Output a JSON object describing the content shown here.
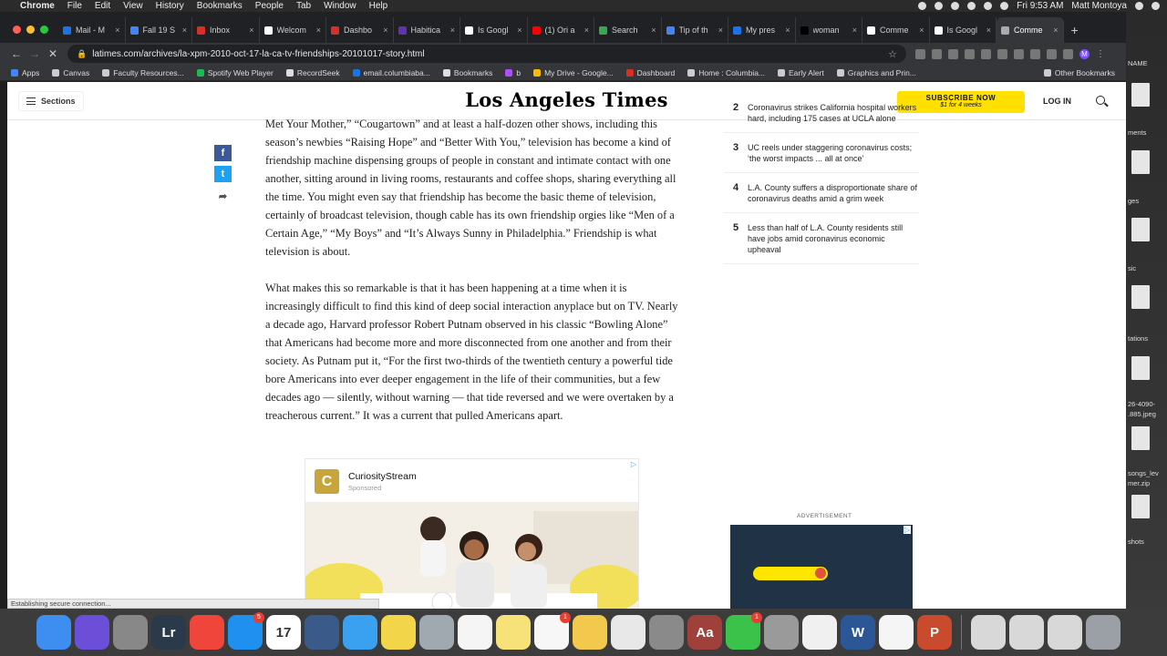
{
  "menubar": {
    "app": "Chrome",
    "items": [
      "File",
      "Edit",
      "View",
      "History",
      "Bookmarks",
      "People",
      "Tab",
      "Window",
      "Help"
    ],
    "clock": "Fri 9:53 AM",
    "user": "Matt Montoya"
  },
  "tabs": [
    {
      "label": "Mail - M",
      "color": "#1a73e8"
    },
    {
      "label": "Fall 19 S",
      "color": "#4285f4"
    },
    {
      "label": "Inbox",
      "color": "#d93025"
    },
    {
      "label": "Welcom",
      "color": "#ffffff"
    },
    {
      "label": "Dashbo",
      "color": "#d93025"
    },
    {
      "label": "Habitica",
      "color": "#6133b4"
    },
    {
      "label": "Is Googl",
      "color": "#ffffff"
    },
    {
      "label": "(1) Ori a",
      "color": "#ff0000"
    },
    {
      "label": "Search",
      "color": "#34a853"
    },
    {
      "label": "Tip of th",
      "color": "#4285f4"
    },
    {
      "label": "My pres",
      "color": "#1a73e8"
    },
    {
      "label": "woman",
      "color": "#000000"
    },
    {
      "label": "Comme",
      "color": "#ffffff"
    },
    {
      "label": "Is Googl",
      "color": "#ffffff"
    },
    {
      "label": "Comme",
      "color": "#aaaaaa"
    }
  ],
  "toolbar": {
    "url": "latimes.com/archives/la-xpm-2010-oct-17-la-ca-tv-friendships-20101017-story.html",
    "avatar": "M"
  },
  "bookmarks": [
    {
      "label": "Apps",
      "color": "#4285f4"
    },
    {
      "label": "Canvas",
      "color": "#cccccc"
    },
    {
      "label": "Faculty Resources...",
      "color": "#cccccc"
    },
    {
      "label": "Spotify Web Player",
      "color": "#1db954"
    },
    {
      "label": "RecordSeek",
      "color": "#dddddd"
    },
    {
      "label": "email.columbiaba...",
      "color": "#1a73e8"
    },
    {
      "label": "Bookmarks",
      "color": "#dddddd"
    },
    {
      "label": "b",
      "color": "#b04dff"
    },
    {
      "label": "My Drive - Google...",
      "color": "#fbbc04"
    },
    {
      "label": "Dashboard",
      "color": "#d93025"
    },
    {
      "label": "Home : Columbia...",
      "color": "#cccccc"
    },
    {
      "label": "Early Alert",
      "color": "#cccccc"
    },
    {
      "label": "Graphics and Prin...",
      "color": "#cccccc"
    }
  ],
  "other_bookmarks": "Other Bookmarks",
  "lat": {
    "sections": "Sections",
    "logo": "Los Angeles Times",
    "subscribe": "SUBSCRIBE NOW",
    "subscribe_offer": "$1 for 4 weeks",
    "login": "LOG IN"
  },
  "article": {
    "p1": "Met Your Mother,” “Cougartown” and at least a half-dozen other shows, including this season’s newbies “Raising Hope” and “Better With You,” television has become a kind of friendship machine dispensing groups of people in constant and intimate contact with one another, sitting around in living rooms, restaurants and coffee shops, sharing everything all the time. You might even say that friendship has become the basic theme of television, certainly of broadcast television, though cable has its own friendship orgies like “Men of a Certain Age,” “My Boys” and “It’s Always Sunny in Philadelphia.” Friendship is what television is about.",
    "p2": "What makes this so remarkable is that it has been happening at a time when it is increasingly difficult to find this kind of deep social interaction anyplace but on TV. Nearly a decade ago, Harvard professor Robert Putnam observed in his classic “Bowling Alone” that Americans had become more and more disconnected from one another and from their society. As Putnam put it, “For the first two-thirds of the twentieth century a powerful tide bore Americans into ever deeper engagement in the life of their communities, but a few decades ago — silently, without warning — that tide reversed and we were overtaken by a treacherous current.” It was a current that pulled Americans apart."
  },
  "ad": {
    "brand": "CuriosityStream",
    "sponsored": "Sponsored"
  },
  "toplist": [
    {
      "num": "2",
      "text": "Coronavirus strikes California hospital workers hard, including 175 cases at UCLA alone"
    },
    {
      "num": "3",
      "text": "UC reels under staggering coronavirus costs; ‘the worst impacts ... all at once’"
    },
    {
      "num": "4",
      "text": "L.A. County suffers a disproportionate share of coronavirus deaths amid a grim week"
    },
    {
      "num": "5",
      "text": "Less than half of L.A. County residents still have jobs amid coronavirus economic upheaval"
    }
  ],
  "advertisement_label": "ADVERTISEMENT",
  "status": "Establishing secure connection...",
  "desktop_labels": [
    "NAME",
    "ments",
    "ges",
    "sic",
    "tations",
    "26-4090-",
    ".885.jpeg",
    "songs_lev",
    "mer.zip",
    "shots"
  ],
  "dock": [
    {
      "name": "finder",
      "color": "#3d8ef0",
      "label": ""
    },
    {
      "name": "siri",
      "color": "#6b4fd8",
      "label": ""
    },
    {
      "name": "launchpad",
      "color": "#888888",
      "label": ""
    },
    {
      "name": "lightroom",
      "color": "#2b3a4a",
      "label": "Lr"
    },
    {
      "name": "news",
      "color": "#f0453a",
      "label": ""
    },
    {
      "name": "app-store",
      "color": "#1f8ff0",
      "label": "",
      "badge": "5"
    },
    {
      "name": "calendar",
      "color": "#ffffff",
      "label": "17"
    },
    {
      "name": "quicktime",
      "color": "#3a5a8a",
      "label": ""
    },
    {
      "name": "safari",
      "color": "#3aa0f0",
      "label": ""
    },
    {
      "name": "stickies",
      "color": "#f3d54a",
      "label": ""
    },
    {
      "name": "preview",
      "color": "#a0a8b0",
      "label": ""
    },
    {
      "name": "textedit",
      "color": "#f5f5f5",
      "label": ""
    },
    {
      "name": "notes",
      "color": "#f7e27a",
      "label": ""
    },
    {
      "name": "reminders",
      "color": "#f7f7f7",
      "label": "",
      "badge": "1"
    },
    {
      "name": "script-editor",
      "color": "#f2c94c",
      "label": ""
    },
    {
      "name": "chrome",
      "color": "#e8e8e8",
      "label": ""
    },
    {
      "name": "system-preferences",
      "color": "#8a8a8a",
      "label": ""
    },
    {
      "name": "dictionary",
      "color": "#a0403a",
      "label": "Aa"
    },
    {
      "name": "facetime",
      "color": "#3bc24a",
      "label": "",
      "badge": "1"
    },
    {
      "name": "calculator",
      "color": "#9a9a9a",
      "label": ""
    },
    {
      "name": "photos",
      "color": "#f0f0f0",
      "label": ""
    },
    {
      "name": "word",
      "color": "#2b5797",
      "label": "W"
    },
    {
      "name": "itunes",
      "color": "#f5f5f5",
      "label": ""
    },
    {
      "name": "powerpoint",
      "color": "#c94a2c",
      "label": "P"
    }
  ]
}
